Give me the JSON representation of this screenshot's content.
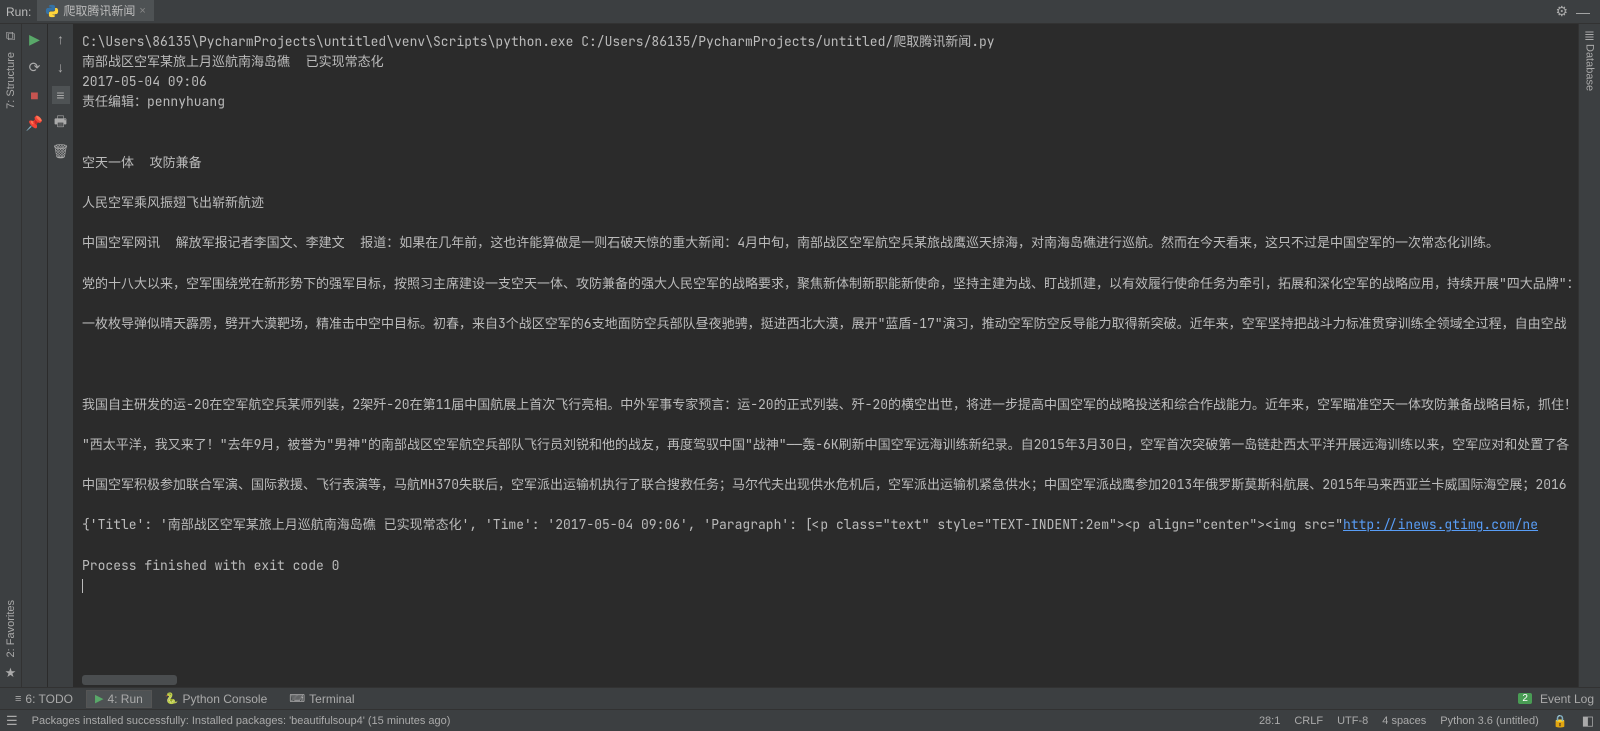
{
  "run": {
    "label": "Run:",
    "tab_title": "爬取腾讯新闻",
    "tab_icon": "python-icon",
    "close_icon": "close-icon",
    "settings_icon": "gear-icon",
    "minimize_icon": "minimize-icon"
  },
  "left_rail": {
    "structure": "7: Structure",
    "favorites": "2: Favorites"
  },
  "right_rail": {
    "database": "Database"
  },
  "console": {
    "line1": "C:\\Users\\86135\\PycharmProjects\\untitled\\venv\\Scripts\\python.exe C:/Users/86135/PycharmProjects/untitled/爬取腾讯新闻.py",
    "line2": "南部战区空军某旅上月巡航南海岛礁  已实现常态化",
    "line3": "2017-05-04 09:06",
    "line4": "责任编辑：pennyhuang",
    "line5": "",
    "line6": "",
    "line7": "空天一体  攻防兼备",
    "line8": "",
    "line9": "人民空军乘风振翅飞出崭新航迹",
    "line10": "",
    "line11": "中国空军网讯  解放军报记者李国文、李建文  报道：如果在几年前，这也许能算做是一则石破天惊的重大新闻：4月中旬，南部战区空军航空兵某旅战鹰巡天掠海，对南海岛礁进行巡航。然而在今天看来，这只不过是中国空军的一次常态化训练。",
    "line12": "",
    "line13": "党的十八大以来，空军围绕党在新形势下的强军目标，按照习主席建设一支空天一体、攻防兼备的强大人民空军的战略要求，聚焦新体制新职能新使命，坚持主建为战、盯战抓建，以有效履行使命任务为牵引，拓展和深化空军的战略应用，持续开展\"四大品牌\"：",
    "line14": "",
    "line15": "一枚枚导弹似晴天霹雳，劈开大漠靶场，精准击中空中目标。初春，来自3个战区空军的6支地面防空兵部队昼夜驰骋，挺进西北大漠，展开\"蓝盾-17\"演习，推动空军防空反导能力取得新突破。近年来，空军坚持把战斗力标准贯穿训练全领域全过程，自由空战",
    "line16": "",
    "line17": "",
    "line18": "",
    "line19": "我国自主研发的运-20在空军航空兵某师列装，2架歼-20在第11届中国航展上首次飞行亮相。中外军事专家预言：运-20的正式列装、歼-20的横空出世，将进一步提高中国空军的战略投送和综合作战能力。近年来，空军瞄准空天一体攻防兼备战略目标，抓住！",
    "line20": "",
    "line21": "\"西太平洋，我又来了！\"去年9月，被誉为\"男神\"的南部战区空军航空兵部队飞行员刘锐和他的战友，再度驾驭中国\"战神\"——轰-6K刷新中国空军远海训练新纪录。自2015年3月30日，空军首次突破第一岛链赴西太平洋开展远海训练以来，空军应对和处置了各",
    "line22": "",
    "line23": "中国空军积极参加联合军演、国际救援、飞行表演等，马航MH370失联后，空军派出运输机执行了联合搜救任务；马尔代夫出现供水危机后，空军派出运输机紧急供水；中国空军派战鹰参加2013年俄罗斯莫斯科航展、2015年马来西亚兰卡威国际海空展；2016",
    "line24": "",
    "json_prefix": "{'Title': '南部战区空军某旅上月巡航南海岛礁 已实现常态化', 'Time': '2017-05-04 09:06', 'Paragraph': [<p class=\"text\" style=\"TEXT-INDENT:2em\"><p align=\"center\"><img src=\"",
    "json_link": "http://inews.gtimg.com/ne",
    "line26": "",
    "line27": "Process finished with exit code 0"
  },
  "tool_icons": {
    "run": "run-icon",
    "rerun": "rerun-icon",
    "stop": "stop-icon",
    "pin": "pin-icon",
    "up": "up-arrow-icon",
    "down": "down-arrow-icon",
    "wrap": "soft-wrap-icon",
    "print": "print-icon",
    "trash": "trash-icon"
  },
  "bottom_tabs": {
    "todo": "6: TODO",
    "run": "4: Run",
    "python_console": "Python Console",
    "terminal": "Terminal",
    "event_log": "Event Log",
    "event_badge": "2"
  },
  "status": {
    "message_icon": "package-icon",
    "message": "Packages installed successfully: Installed packages: 'beautifulsoup4' (15 minutes ago)",
    "position": "28:1",
    "line_sep": "CRLF",
    "encoding": "UTF-8",
    "indent": "4 spaces",
    "interpreter": "Python 3.6 (untitled)",
    "lock_icon": "lock-icon",
    "inspector_icon": "inspector-icon"
  }
}
